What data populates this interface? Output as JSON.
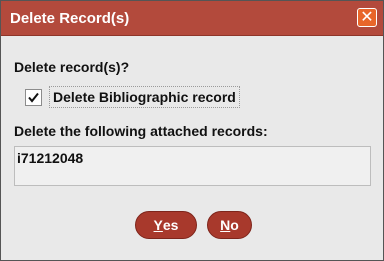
{
  "dialog": {
    "title": "Delete Record(s)",
    "close_glyph": "✕"
  },
  "content": {
    "question": "Delete record(s)?",
    "checkbox": {
      "label": "Delete Bibliographic record",
      "checked": true
    },
    "attached_label": "Delete the following attached records:",
    "attached_records": [
      "i71212048"
    ]
  },
  "buttons": {
    "yes": {
      "mnemonic": "Y",
      "rest": "es"
    },
    "no": {
      "mnemonic": "N",
      "rest": "o"
    }
  },
  "colors": {
    "titlebar": "#b34a3c",
    "close_button": "#e8662a",
    "button": "#a8392c",
    "panel": "#e9e9e9"
  },
  "icons": {
    "close": "close-icon",
    "check": "checkmark-icon"
  }
}
